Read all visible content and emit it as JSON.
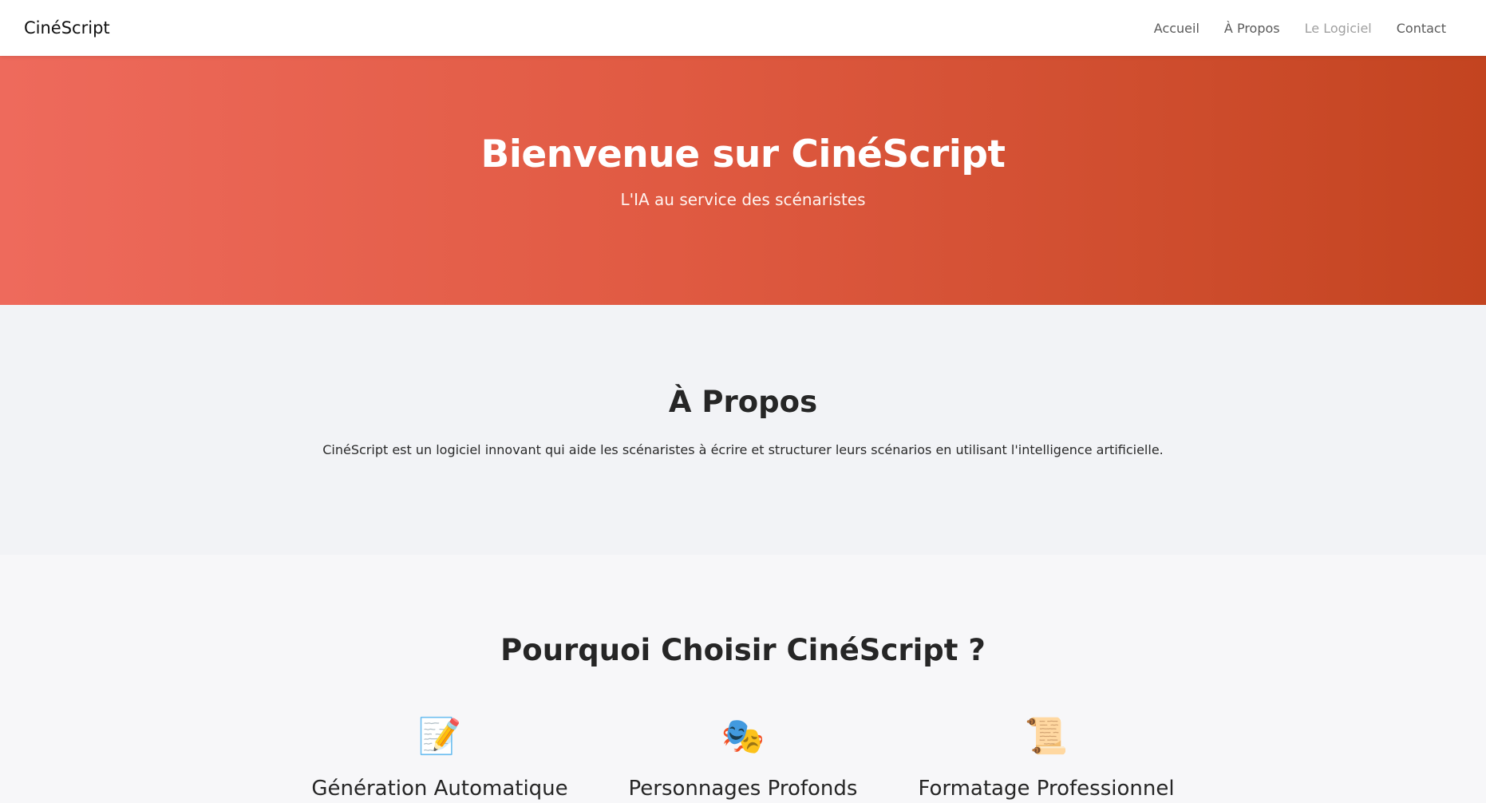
{
  "navbar": {
    "brand": "CinéScript",
    "links": [
      {
        "label": "Accueil"
      },
      {
        "label": "À Propos"
      },
      {
        "label": "Le Logiciel"
      },
      {
        "label": "Contact"
      }
    ]
  },
  "hero": {
    "title": "Bienvenue sur CinéScript",
    "subtitle": "L'IA au service des scénaristes"
  },
  "about": {
    "title": "À Propos",
    "text": "CinéScript est un logiciel innovant qui aide les scénaristes à écrire et structurer leurs scénarios en utilisant l'intelligence artificielle."
  },
  "features": {
    "title": "Pourquoi Choisir CinéScript ?",
    "items": [
      {
        "icon": "memo-pencil-icon",
        "glyph": "📝",
        "title": "Génération Automatique"
      },
      {
        "icon": "theater-masks-icon",
        "glyph": "🎭",
        "title": "Personnages Profonds"
      },
      {
        "icon": "scroll-icon",
        "glyph": "📜",
        "title": "Formatage Professionnel"
      }
    ]
  },
  "colors": {
    "hero_gradient_start": "#ee6a5c",
    "hero_gradient_end": "#c34420",
    "about_bg": "#f2f3f6",
    "page_bg": "#f7f7f9"
  }
}
